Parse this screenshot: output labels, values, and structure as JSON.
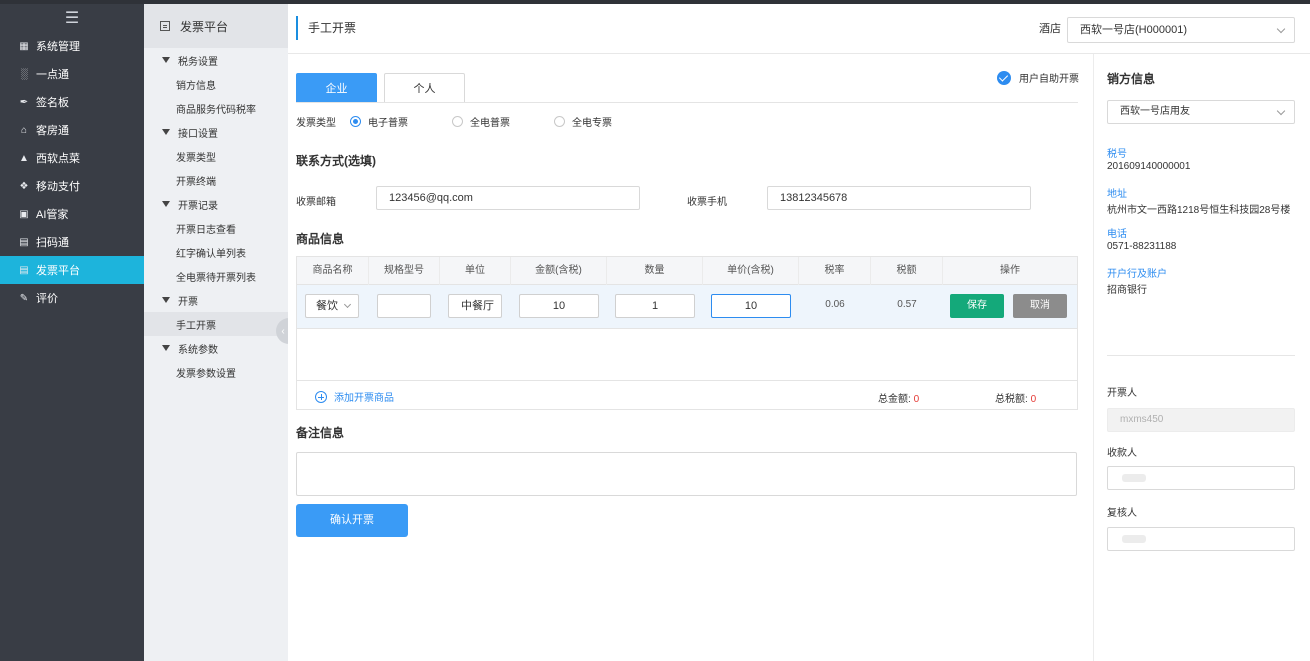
{
  "nav": {
    "toggle_icon": "menu-icon",
    "items": [
      {
        "label": "系统管理",
        "icon": "grid-icon"
      },
      {
        "label": "一点通",
        "icon": "bar-chart-icon"
      },
      {
        "label": "签名板",
        "icon": "pen-icon"
      },
      {
        "label": "客房通",
        "icon": "home-icon"
      },
      {
        "label": "西软点菜",
        "icon": "cloche-icon"
      },
      {
        "label": "移动支付",
        "icon": "coin-icon"
      },
      {
        "label": "AI管家",
        "icon": "robot-icon"
      },
      {
        "label": "扫码通",
        "icon": "scan-icon"
      },
      {
        "label": "发票平台",
        "icon": "invoice-icon"
      },
      {
        "label": "评价",
        "icon": "edit-icon"
      }
    ]
  },
  "subnav": {
    "title": "发票平台",
    "groups": [
      {
        "label": "税务设置",
        "items": [
          "销方信息",
          "商品服务代码税率"
        ]
      },
      {
        "label": "接口设置",
        "items": [
          "发票类型",
          "开票终端"
        ]
      },
      {
        "label": "开票记录",
        "items": [
          "开票日志查看",
          "红字确认单列表",
          "全电票待开票列表"
        ]
      },
      {
        "label": "开票",
        "items": [
          "手工开票"
        ]
      },
      {
        "label": "系统参数",
        "items": [
          "发票参数设置"
        ]
      }
    ]
  },
  "header": {
    "title": "手工开票",
    "hotel_label": "酒店",
    "hotel_value": "西软一号店(H000001)"
  },
  "tabs": {
    "enterprise": "企业",
    "personal": "个人"
  },
  "self_service": "用户自助开票",
  "invoice_type": {
    "label": "发票类型",
    "options": [
      "电子普票",
      "全电普票",
      "全电专票"
    ],
    "selected": "电子普票"
  },
  "contact": {
    "title": "联系方式(选填)",
    "email_label": "收票邮箱",
    "email_value": "123456@qq.com",
    "phone_label": "收票手机",
    "phone_value": "13812345678"
  },
  "goods": {
    "title": "商品信息",
    "columns": [
      "商品名称",
      "规格型号",
      "单位",
      "金额(含税)",
      "数量",
      "单价(含税)",
      "税率",
      "税额",
      "操作"
    ],
    "row": {
      "name": "餐饮",
      "spec": "",
      "unit": "中餐厅",
      "amount": "10",
      "quantity": "1",
      "unit_price": "10",
      "tax_rate": "0.06",
      "tax": "0.57"
    },
    "save": "保存",
    "cancel": "取消",
    "add": "添加开票商品",
    "total_amount_label": "总金额:",
    "total_amount": "0",
    "total_tax_label": "总税额:",
    "total_tax": "0"
  },
  "remark": {
    "title": "备注信息"
  },
  "confirm": "确认开票",
  "seller": {
    "title": "销方信息",
    "select": "西软一号店用友",
    "tax_no_label": "税号",
    "tax_no": "201609140000001",
    "address_label": "地址",
    "address": "杭州市文一西路1218号恒生科技园28号楼",
    "phone_label": "电话",
    "phone": "0571-88231188",
    "bank_label": "开户行及账户",
    "bank": "招商银行",
    "issuer_label": "开票人",
    "issuer": "mxms450",
    "payee_label": "收款人",
    "reviewer_label": "复核人"
  },
  "colors": {
    "nav_bg": "#393d45",
    "nav_active": "#1db4dc",
    "primary": "#3a9bf6",
    "save": "#14a97a",
    "cancel": "#8c8c8c",
    "total": "#e53935"
  }
}
